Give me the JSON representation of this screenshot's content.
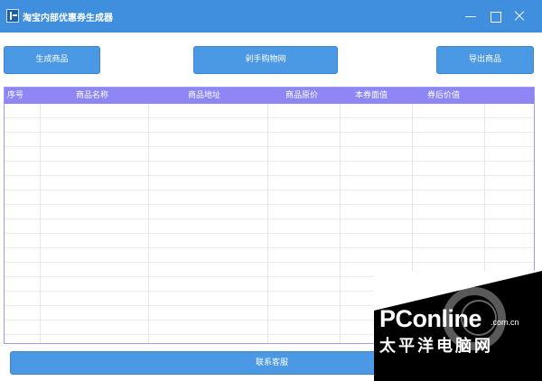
{
  "window": {
    "title": "淘宝内部优惠券生成器",
    "controls": [
      "minimize-icon",
      "maximize-icon",
      "close-icon"
    ]
  },
  "toolbar": {
    "generate_label": "生成商品",
    "snap_label": "剁手购物网",
    "export_label": "导出商品"
  },
  "table": {
    "columns": [
      "序号",
      "商品名称",
      "商品地址",
      "商品原价",
      "本券面值",
      "券后价值"
    ],
    "rows": []
  },
  "footer": {
    "contact_label": "联系客服"
  },
  "watermark": {
    "logo": "PConline",
    "domain": ".com.cn",
    "subtitle": "太平洋电脑网"
  },
  "colors": {
    "titlebar": "#3f8fde",
    "button": "#4b98e4",
    "grid_header": "#8e86f5"
  }
}
